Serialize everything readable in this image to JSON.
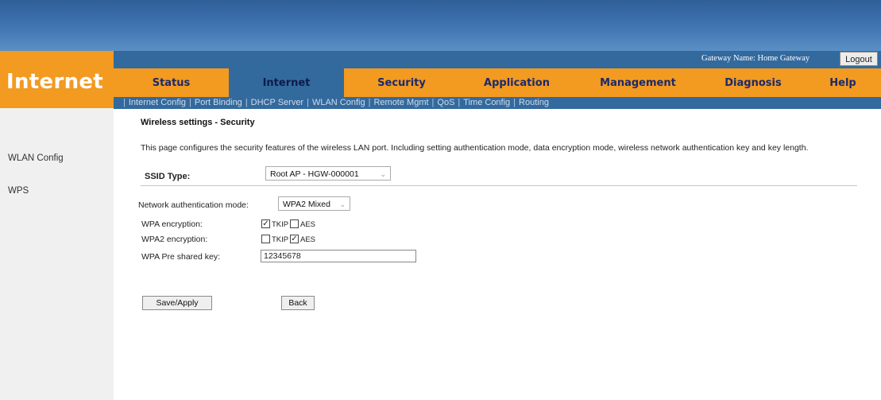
{
  "header": {
    "brand": "Internet",
    "gateway_label": "Gateway Name: Home Gateway",
    "logout_label": "Logout"
  },
  "main_nav": [
    {
      "label": "Status",
      "active": false
    },
    {
      "label": "Internet",
      "active": true
    },
    {
      "label": "Security",
      "active": false
    },
    {
      "label": "Application",
      "active": false
    },
    {
      "label": "Management",
      "active": false
    },
    {
      "label": "Diagnosis",
      "active": false
    },
    {
      "label": "Help",
      "active": false
    }
  ],
  "sub_nav": [
    "Internet Config",
    "Port Binding",
    "DHCP Server",
    "WLAN Config",
    "Remote Mgmt",
    "QoS",
    "Time Config",
    "Routing"
  ],
  "sidebar": {
    "items": [
      "WLAN Config",
      "WPS"
    ]
  },
  "page": {
    "title": "Wireless settings - Security",
    "description": "This page configures the security features of the wireless LAN port. Including setting authentication mode, data encryption mode, wireless network authentication key and key length."
  },
  "form": {
    "ssid_type_label": "SSID Type:",
    "ssid_type_value": "Root AP - HGW-000001",
    "auth_mode_label": "Network authentication mode:",
    "auth_mode_value": "WPA2 Mixed",
    "wpa_encryption_label": "WPA encryption:",
    "wpa2_encryption_label": "WPA2 encryption:",
    "tkip_label": "TKIP",
    "aes_label": "AES",
    "wpa_tkip_checked": true,
    "wpa_aes_checked": false,
    "wpa2_tkip_checked": false,
    "wpa2_aes_checked": true,
    "psk_label": "WPA Pre shared key:",
    "psk_value": "12345678"
  },
  "buttons": {
    "save_apply": "Save/Apply",
    "back": "Back"
  },
  "colors": {
    "banner": "#3f76b3",
    "accent_orange": "#f39a21",
    "nav_blue": "#336a9e",
    "nav_text": "#1a2a6a"
  },
  "icons": {
    "select_arrow": "chevron-down-icon",
    "checkbox_mark": "check-icon"
  }
}
